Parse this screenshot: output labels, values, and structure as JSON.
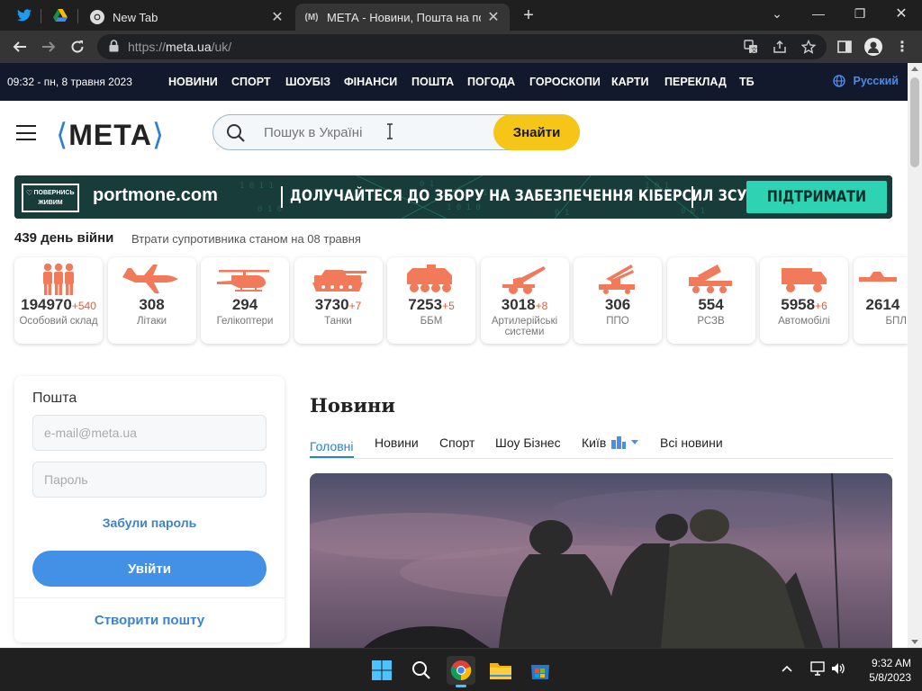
{
  "browser": {
    "tabs": [
      {
        "title": "New Tab"
      },
      {
        "title": "МЕТА - Новини, Пошта на порт"
      }
    ],
    "url_prefix": "https://",
    "url_host": "meta.ua",
    "url_path": "/uk/"
  },
  "site_nav": {
    "datetime": "09:32 - пн, 8 травня 2023",
    "items": [
      "НОВИНИ",
      "СПОРТ",
      "ШОУБІЗ",
      "ФІНАНСИ",
      "ПОШТА",
      "ПОГОДА",
      "ГОРОСКОПИ",
      "КАРТИ",
      "ПЕРЕКЛАД",
      "ТБ"
    ],
    "language": "Русский"
  },
  "header": {
    "logo": "МЕТА",
    "search_placeholder": "Пошук в Україні",
    "search_button": "Знайти"
  },
  "banner": {
    "badge_line1": "ПОВЕРНИСЬ",
    "badge_line2": "ЖИВИМ",
    "brand": "portmone.com",
    "slogan": "ДОЛУЧАЙТЕСЯ ДО ЗБОРУ НА ЗАБЕЗПЕЧЕННЯ КІБЕРСИЛ ЗСУ",
    "cta": "ПІДТРИМАТИ"
  },
  "war": {
    "days": "439 день війни",
    "subtitle": "Втрати супротивника станом на 08 травня",
    "cards": [
      {
        "icon": "soldiers-icon",
        "value": "194970",
        "inc": "+540",
        "label": "Особовий склад"
      },
      {
        "icon": "plane-icon",
        "value": "308",
        "inc": "",
        "label": "Літаки"
      },
      {
        "icon": "helicopter-icon",
        "value": "294",
        "inc": "",
        "label": "Гелікоптери"
      },
      {
        "icon": "tank-icon",
        "value": "3730",
        "inc": "+7",
        "label": "Танки"
      },
      {
        "icon": "apc-icon",
        "value": "7253",
        "inc": "+5",
        "label": "ББМ"
      },
      {
        "icon": "artillery-icon",
        "value": "3018",
        "inc": "+8",
        "label": "Артилерійські системи"
      },
      {
        "icon": "air-defense-icon",
        "value": "306",
        "inc": "",
        "label": "ППО"
      },
      {
        "icon": "mlrs-icon",
        "value": "554",
        "inc": "",
        "label": "РСЗВ"
      },
      {
        "icon": "truck-icon",
        "value": "5958",
        "inc": "+6",
        "label": "Автомобілі"
      },
      {
        "icon": "drone-icon",
        "value": "2614",
        "inc": "",
        "label": "БПЛ"
      }
    ]
  },
  "mail": {
    "title": "Пошта",
    "email_placeholder": "e-mail@meta.ua",
    "password_placeholder": "Пароль",
    "forgot": "Забули пароль",
    "login": "Увійти",
    "create": "Створити пошту"
  },
  "news": {
    "title": "Новини",
    "tabs": [
      "Головні",
      "Новини",
      "Спорт",
      "Шоу Бізнес",
      "Київ",
      "Всі новини"
    ]
  },
  "taskbar": {
    "time": "9:32 AM",
    "date": "5/8/2023"
  },
  "colors": {
    "accent": "#f5c518",
    "brand_blue": "#2b7fd4",
    "loss_icon": "#f07a5a",
    "nav_bg": "#12192c"
  }
}
